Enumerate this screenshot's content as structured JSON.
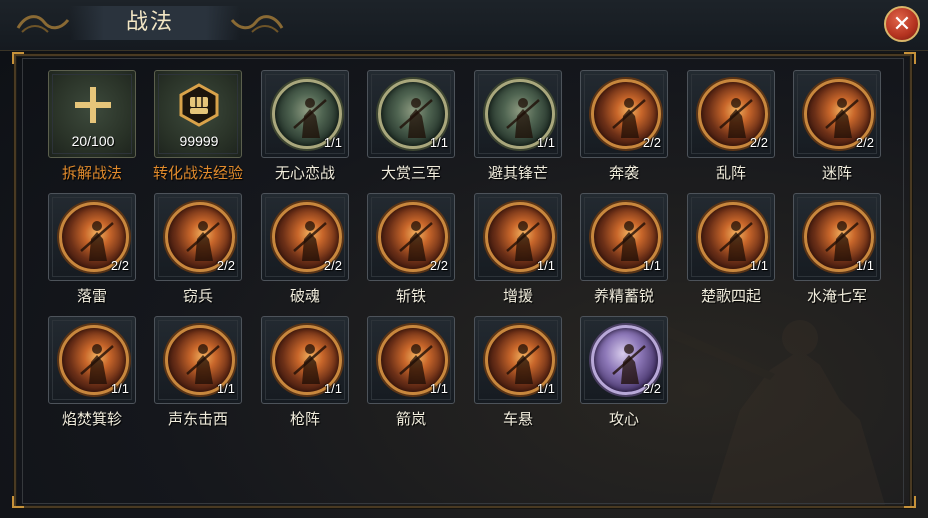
{
  "window": {
    "title": "战法",
    "close_label": "✕"
  },
  "special": [
    {
      "name": "拆解战法",
      "count": "20/100",
      "icon": "plus-icon"
    },
    {
      "name": "转化战法经验",
      "count": "99999",
      "icon": "fist-emblem-icon"
    }
  ],
  "skills": [
    {
      "name": "无心恋战",
      "count": "1/1",
      "style": "green"
    },
    {
      "name": "大赏三军",
      "count": "1/1",
      "style": "green"
    },
    {
      "name": "避其锋芒",
      "count": "1/1",
      "style": "green"
    },
    {
      "name": "奔袭",
      "count": "2/2",
      "style": "fire"
    },
    {
      "name": "乱阵",
      "count": "2/2",
      "style": "fire"
    },
    {
      "name": "迷阵",
      "count": "2/2",
      "style": "fire"
    },
    {
      "name": "落雷",
      "count": "2/2",
      "style": "fire"
    },
    {
      "name": "窃兵",
      "count": "2/2",
      "style": "fire"
    },
    {
      "name": "破魂",
      "count": "2/2",
      "style": "fire"
    },
    {
      "name": "斩铁",
      "count": "2/2",
      "style": "fire"
    },
    {
      "name": "增援",
      "count": "1/1",
      "style": "fire"
    },
    {
      "name": "养精蓄锐",
      "count": "1/1",
      "style": "fire"
    },
    {
      "name": "楚歌四起",
      "count": "1/1",
      "style": "fire"
    },
    {
      "name": "水淹七军",
      "count": "1/1",
      "style": "fire"
    },
    {
      "name": "焰焚箕轸",
      "count": "1/1",
      "style": "fire"
    },
    {
      "name": "声东击西",
      "count": "1/1",
      "style": "fire"
    },
    {
      "name": "枪阵",
      "count": "1/1",
      "style": "fire"
    },
    {
      "name": "箭岚",
      "count": "1/1",
      "style": "fire"
    },
    {
      "name": "车悬",
      "count": "1/1",
      "style": "fire"
    },
    {
      "name": "攻心",
      "count": "2/2",
      "style": "purple"
    }
  ],
  "colors": {
    "accent_orange": "#e08a2c",
    "label_text": "#f0ecdc",
    "frame_gold": "#c7923a"
  }
}
